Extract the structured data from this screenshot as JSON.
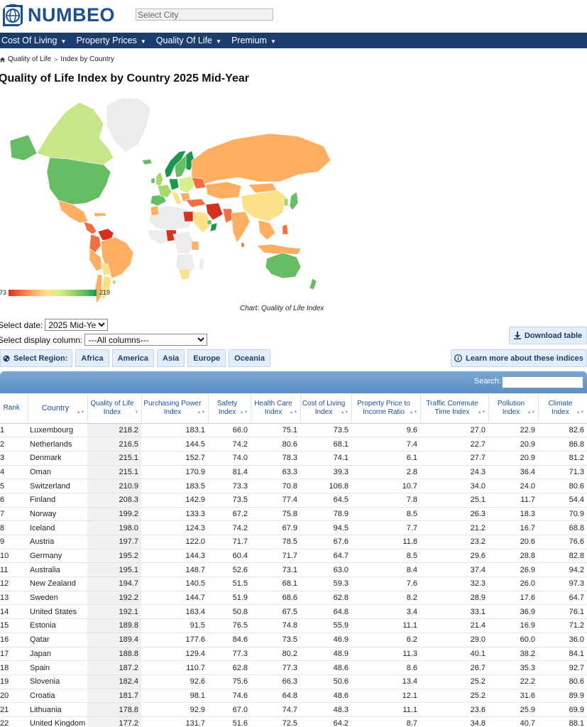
{
  "header": {
    "logo_text": "NUMBEO",
    "city_placeholder": "Select City"
  },
  "nav": {
    "items": [
      {
        "label": "Cost Of Living"
      },
      {
        "label": "Property Prices"
      },
      {
        "label": "Quality Of Life"
      },
      {
        "label": "Premium"
      }
    ]
  },
  "breadcrumb": {
    "items": [
      "Quality of Life",
      "Index by Country"
    ]
  },
  "page_title": "Quality of Life Index by Country 2025 Mid-Year",
  "map": {
    "legend_min": "73",
    "legend_max": "219",
    "caption": "Chart: Quality of Life Index",
    "colors": {
      "low": "#d7301f",
      "mid": "#fee08b",
      "high": "#1a9850",
      "no_data": "#e6e6e6"
    }
  },
  "controls": {
    "date_label": "Select date:",
    "date_value": "2025 Mid-Year",
    "column_label": "Select display column:",
    "column_value": "---All columns---",
    "download_label": "Download table",
    "learn_label": "Learn more about these indices",
    "region_label": "Select Region:",
    "regions": [
      "Africa",
      "America",
      "Asia",
      "Europe",
      "Oceania"
    ],
    "search_label": "Search:"
  },
  "table": {
    "headers": [
      "Rank",
      "Country",
      "Quality of Life Index",
      "Purchasing Power Index",
      "Safety Index",
      "Health Care Index",
      "Cost of Living Index",
      "Property Price to Income Ratio",
      "Traffic Commute Time Index",
      "Pollution Index",
      "Climate Index"
    ],
    "rows": [
      [
        "1",
        "Luxembourg",
        "218.2",
        "183.1",
        "66.0",
        "75.1",
        "73.5",
        "9.6",
        "27.0",
        "22.9",
        "82.6"
      ],
      [
        "2",
        "Netherlands",
        "216.5",
        "144.5",
        "74.2",
        "80.6",
        "68.1",
        "7.4",
        "22.7",
        "20.9",
        "86.8"
      ],
      [
        "3",
        "Denmark",
        "215.1",
        "152.7",
        "74.0",
        "78.3",
        "74.1",
        "6.1",
        "27.7",
        "20.9",
        "81.2"
      ],
      [
        "4",
        "Oman",
        "215.1",
        "170.9",
        "81.4",
        "63.3",
        "39.3",
        "2.8",
        "24.3",
        "36.4",
        "71.3"
      ],
      [
        "5",
        "Switzerland",
        "210.9",
        "183.5",
        "73.3",
        "70.8",
        "106.8",
        "10.7",
        "34.0",
        "24.0",
        "80.6"
      ],
      [
        "6",
        "Finland",
        "208.3",
        "142.9",
        "73.5",
        "77.4",
        "64.5",
        "7.8",
        "25.1",
        "11.7",
        "54.4"
      ],
      [
        "7",
        "Norway",
        "199.2",
        "133.3",
        "67.2",
        "75.8",
        "78.9",
        "8.5",
        "26.3",
        "18.3",
        "70.9"
      ],
      [
        "8",
        "Iceland",
        "198.0",
        "124.3",
        "74.2",
        "67.9",
        "94.5",
        "7.7",
        "21.2",
        "16.7",
        "68.8"
      ],
      [
        "9",
        "Austria",
        "197.7",
        "122.0",
        "71.7",
        "78.5",
        "67.6",
        "11.8",
        "23.2",
        "20.6",
        "76.6"
      ],
      [
        "10",
        "Germany",
        "195.2",
        "144.3",
        "60.4",
        "71.7",
        "64.7",
        "8.5",
        "29.6",
        "28.8",
        "82.8"
      ],
      [
        "11",
        "Australia",
        "195.1",
        "148.7",
        "52.6",
        "73.1",
        "63.0",
        "8.4",
        "37.4",
        "26.9",
        "94.2"
      ],
      [
        "12",
        "New Zealand",
        "194.7",
        "140.5",
        "51.5",
        "68.1",
        "59.3",
        "7.6",
        "32.3",
        "26.0",
        "97.3"
      ],
      [
        "13",
        "Sweden",
        "192.2",
        "144.7",
        "51.9",
        "68.6",
        "62.8",
        "8.2",
        "28.9",
        "17.6",
        "64.7"
      ],
      [
        "14",
        "United States",
        "192.1",
        "163.4",
        "50.8",
        "67.5",
        "64.8",
        "3.4",
        "33.1",
        "36.9",
        "76.1"
      ],
      [
        "15",
        "Estonia",
        "189.8",
        "91.5",
        "76.5",
        "74.8",
        "55.9",
        "11.1",
        "21.4",
        "16.9",
        "71.2"
      ],
      [
        "16",
        "Qatar",
        "189.4",
        "177.6",
        "84.6",
        "73.5",
        "46.9",
        "6.2",
        "29.0",
        "60.0",
        "36.0"
      ],
      [
        "17",
        "Japan",
        "188.8",
        "129.4",
        "77.3",
        "80.2",
        "48.9",
        "11.3",
        "40.1",
        "38.2",
        "84.1"
      ],
      [
        "18",
        "Spain",
        "187.2",
        "110.7",
        "62.8",
        "77.3",
        "48.6",
        "8.6",
        "26.7",
        "35.3",
        "92.7"
      ],
      [
        "19",
        "Slovenia",
        "182.4",
        "92.6",
        "75.6",
        "66.3",
        "50.6",
        "13.4",
        "25.2",
        "22.2",
        "80.6"
      ],
      [
        "20",
        "Croatia",
        "181.7",
        "98.1",
        "74.6",
        "64.8",
        "48.6",
        "12.1",
        "25.2",
        "31.6",
        "89.9"
      ],
      [
        "21",
        "Lithuania",
        "178.8",
        "92.9",
        "67.0",
        "74.7",
        "48.3",
        "11.1",
        "23.6",
        "25.9",
        "69.9"
      ],
      [
        "22",
        "United Kingdom",
        "177.2",
        "131.7",
        "51.6",
        "72.5",
        "64.2",
        "8.7",
        "34.8",
        "40.7",
        "88.1"
      ]
    ]
  }
}
